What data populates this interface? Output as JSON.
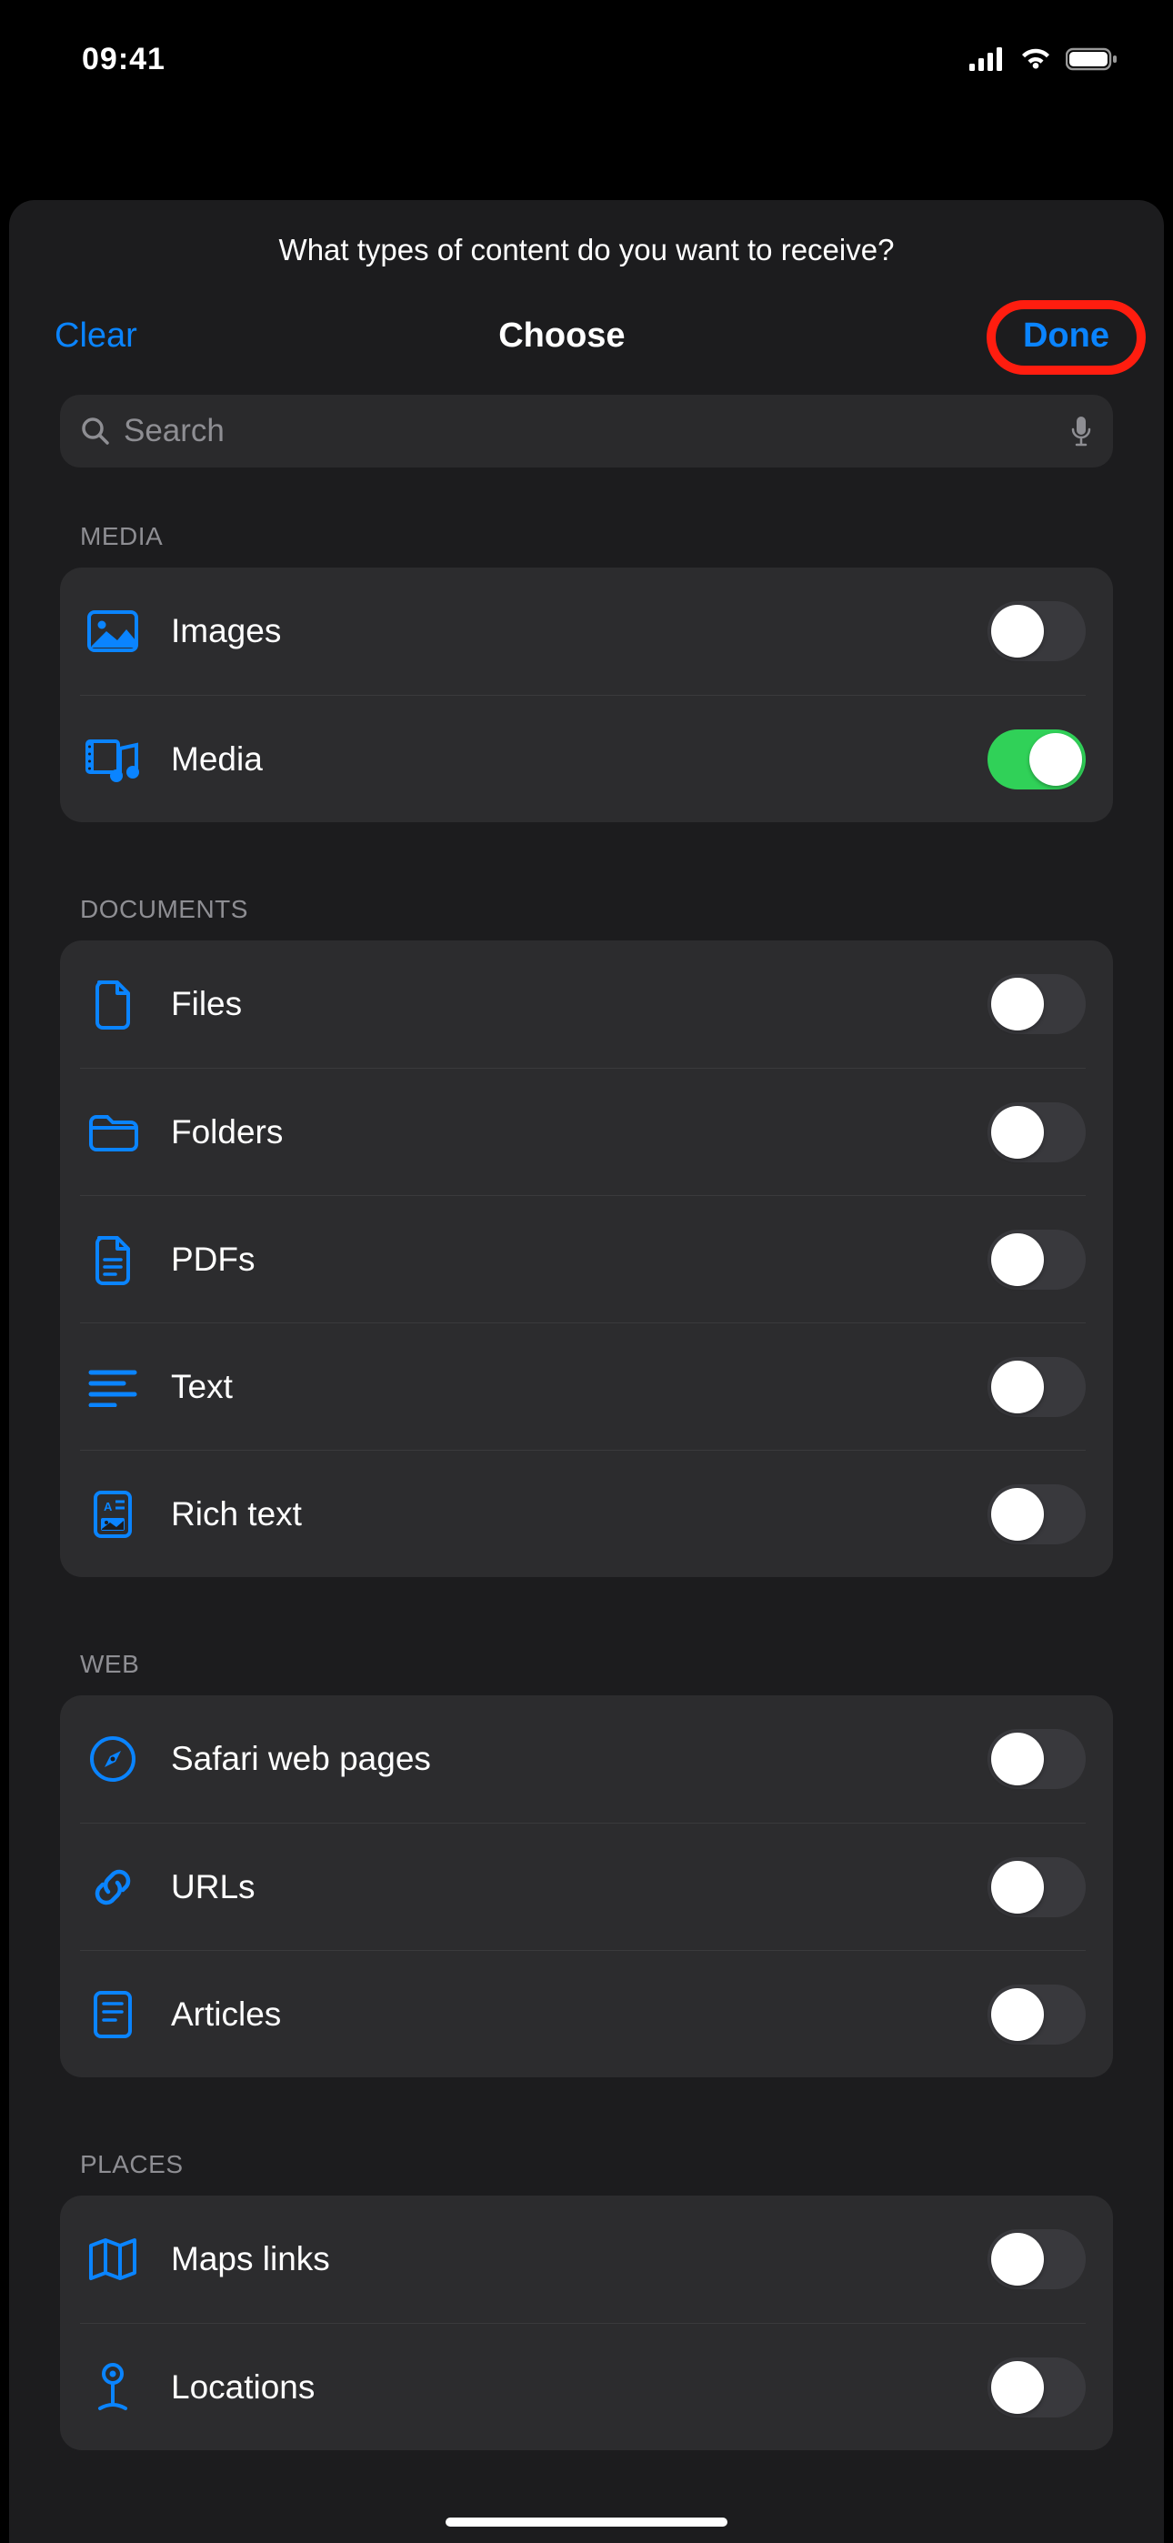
{
  "status": {
    "time": "09:41"
  },
  "sheet": {
    "question": "What types of content do you want to receive?",
    "nav": {
      "clear": "Clear",
      "title": "Choose",
      "done": "Done"
    },
    "search": {
      "placeholder": "Search"
    }
  },
  "sections": [
    {
      "header": "Media",
      "rows": [
        {
          "icon": "image-icon",
          "label": "Images",
          "on": false
        },
        {
          "icon": "media-icon",
          "label": "Media",
          "on": true
        }
      ]
    },
    {
      "header": "Documents",
      "rows": [
        {
          "icon": "file-icon",
          "label": "Files",
          "on": false
        },
        {
          "icon": "folder-icon",
          "label": "Folders",
          "on": false
        },
        {
          "icon": "pdf-icon",
          "label": "PDFs",
          "on": false
        },
        {
          "icon": "text-icon",
          "label": "Text",
          "on": false
        },
        {
          "icon": "richtext-icon",
          "label": "Rich text",
          "on": false
        }
      ]
    },
    {
      "header": "Web",
      "rows": [
        {
          "icon": "compass-icon",
          "label": "Safari web pages",
          "on": false
        },
        {
          "icon": "link-icon",
          "label": "URLs",
          "on": false
        },
        {
          "icon": "article-icon",
          "label": "Articles",
          "on": false
        }
      ]
    },
    {
      "header": "Places",
      "rows": [
        {
          "icon": "map-icon",
          "label": "Maps links",
          "on": false
        },
        {
          "icon": "pin-icon",
          "label": "Locations",
          "on": false
        }
      ]
    }
  ],
  "colors": {
    "accent": "#0a84ff",
    "green": "#30d158",
    "highlight": "#ff1d0f"
  }
}
